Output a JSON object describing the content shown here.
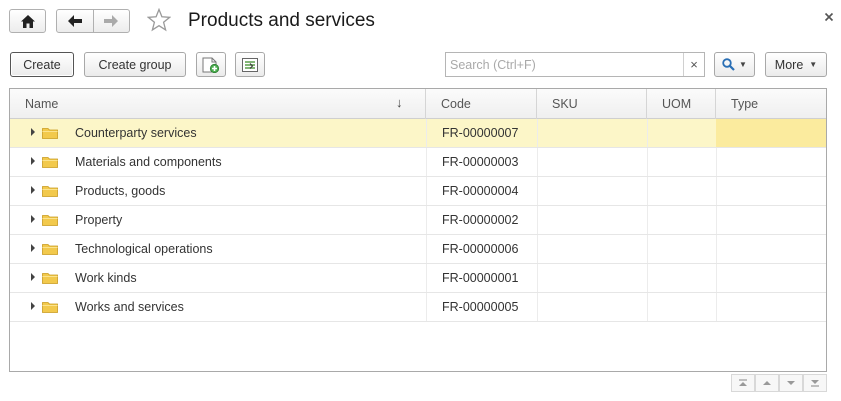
{
  "window": {
    "title": "Products and services",
    "close_symbol": "×"
  },
  "toolbar": {
    "create_label": "Create",
    "create_group_label": "Create group",
    "search_placeholder": "Search (Ctrl+F)",
    "search_value": "",
    "search_clear_symbol": "×",
    "more_label": "More"
  },
  "table": {
    "columns": {
      "name": "Name",
      "code": "Code",
      "sku": "SKU",
      "uom": "UOM",
      "type": "Type"
    },
    "sort_indicator": "↓",
    "rows": [
      {
        "name": "Counterparty services",
        "code": "FR-00000007",
        "sku": "",
        "uom": "",
        "type": "",
        "selected": true
      },
      {
        "name": "Materials and components",
        "code": "FR-00000003",
        "sku": "",
        "uom": "",
        "type": "",
        "selected": false
      },
      {
        "name": "Products, goods",
        "code": "FR-00000004",
        "sku": "",
        "uom": "",
        "type": "",
        "selected": false
      },
      {
        "name": "Property",
        "code": "FR-00000002",
        "sku": "",
        "uom": "",
        "type": "",
        "selected": false
      },
      {
        "name": "Technological operations",
        "code": "FR-00000006",
        "sku": "",
        "uom": "",
        "type": "",
        "selected": false
      },
      {
        "name": "Work kinds",
        "code": "FR-00000001",
        "sku": "",
        "uom": "",
        "type": "",
        "selected": false
      },
      {
        "name": "Works and services",
        "code": "FR-00000005",
        "sku": "",
        "uom": "",
        "type": "",
        "selected": false
      }
    ]
  },
  "icons": {
    "home": "home-icon",
    "back": "arrow-left-icon",
    "forward": "arrow-right-icon",
    "favorite": "star-icon",
    "close": "close-icon",
    "create_folder": "add-folder-icon",
    "list_settings": "list-settings-icon",
    "search": "search-icon",
    "row_expander": "expand-arrow-icon",
    "row_folder": "folder-icon",
    "scroll_first": "scroll-to-top-icon",
    "scroll_up": "scroll-up-icon",
    "scroll_down": "scroll-down-icon",
    "scroll_last": "scroll-to-bottom-icon"
  },
  "colors": {
    "selected_row": "#fcf6c8",
    "selected_cell": "#fbeb9e",
    "folder": "#f2c94c"
  }
}
